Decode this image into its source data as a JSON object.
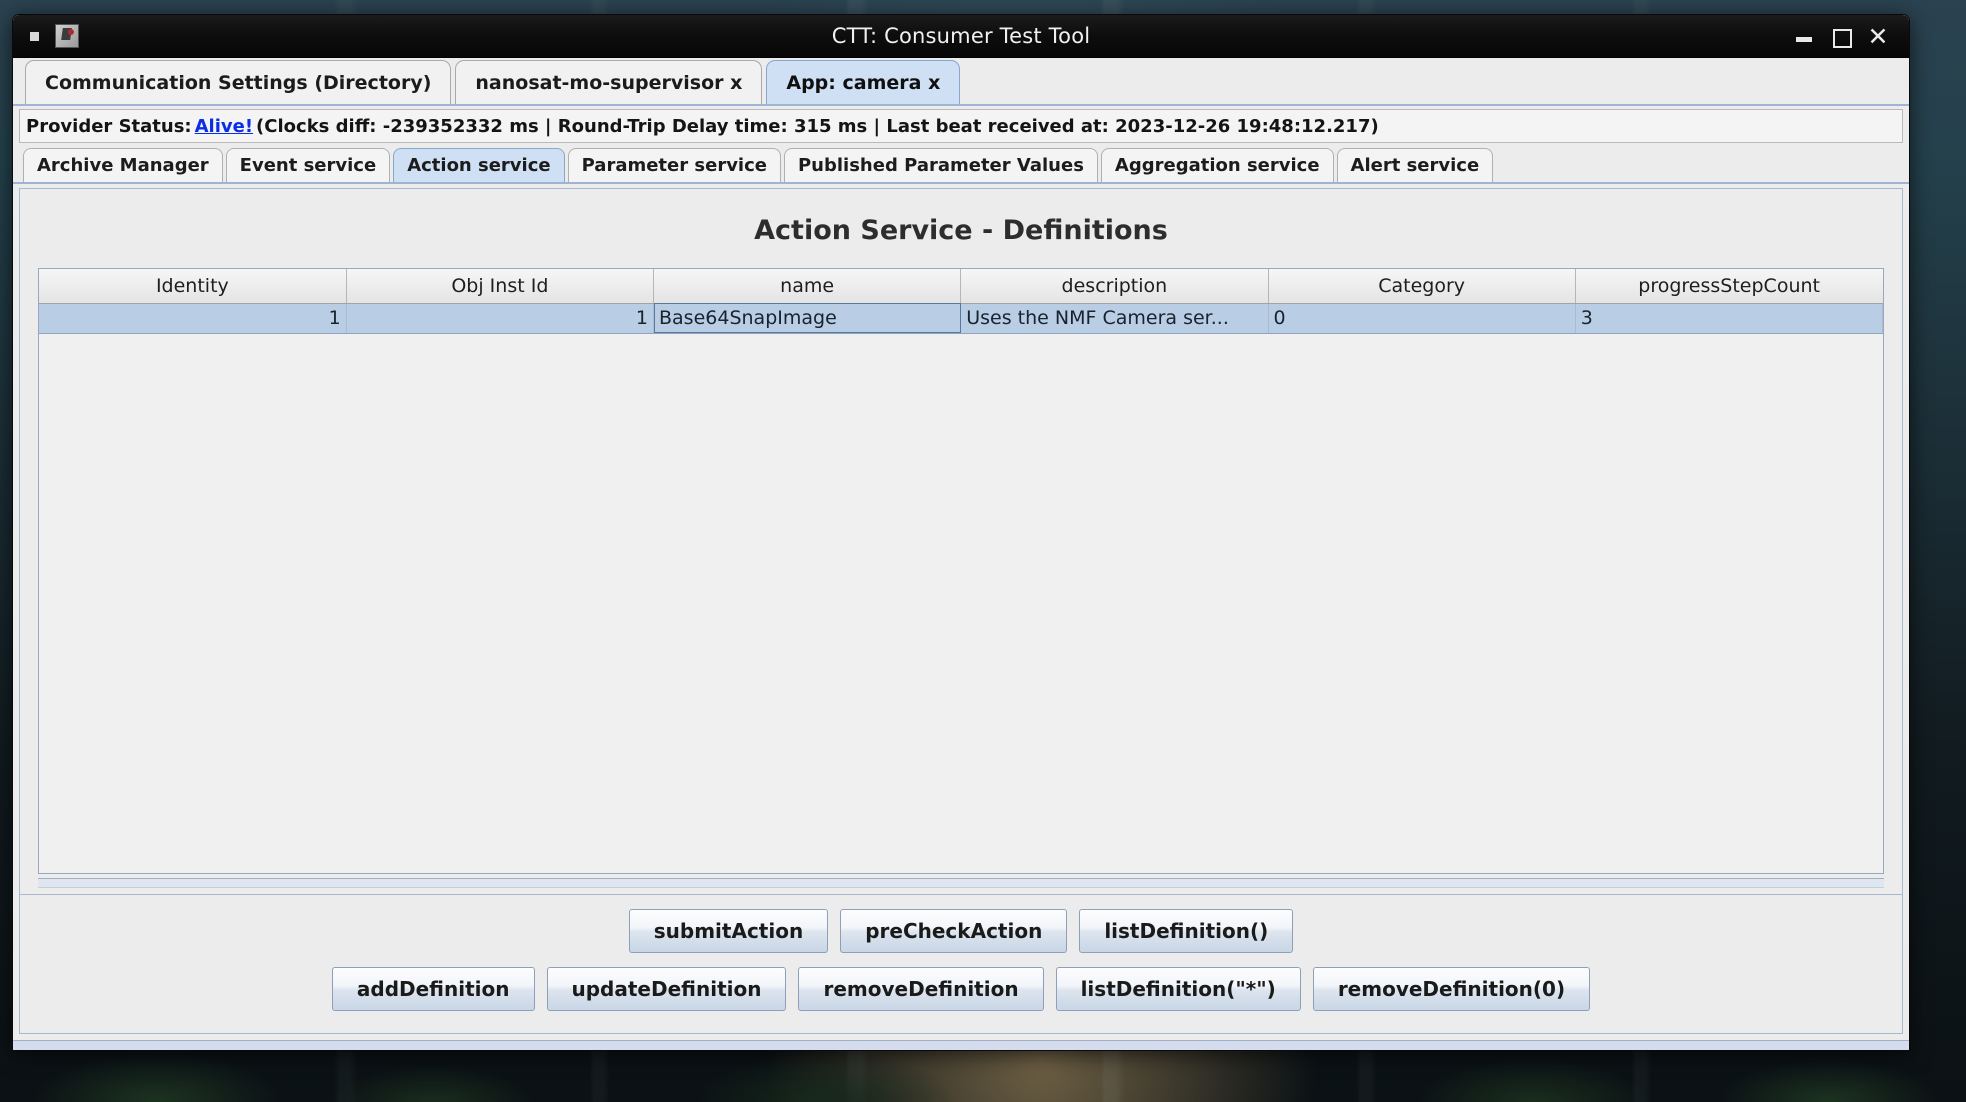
{
  "window": {
    "title": "CTT: Consumer Test Tool",
    "app_icon": "app-icon",
    "controls": {
      "minimize": "minimize-icon",
      "maximize": "maximize-icon",
      "close": "close-icon"
    }
  },
  "top_tabs": [
    {
      "label": "Communication Settings (Directory)",
      "active": false
    },
    {
      "label": "nanosat-mo-supervisor x",
      "active": false
    },
    {
      "label": "App: camera x",
      "active": true
    }
  ],
  "status": {
    "prefix": "Provider Status: ",
    "state": "Alive!",
    "details": " (Clocks diff: -239352332 ms | Round-Trip Delay time: 315 ms | Last beat received at: 2023-12-26 19:48:12.217)"
  },
  "service_tabs": [
    {
      "label": "Archive Manager",
      "active": false
    },
    {
      "label": "Event service",
      "active": false
    },
    {
      "label": "Action service",
      "active": true
    },
    {
      "label": "Parameter service",
      "active": false
    },
    {
      "label": "Published Parameter Values",
      "active": false
    },
    {
      "label": "Aggregation service",
      "active": false
    },
    {
      "label": "Alert service",
      "active": false
    }
  ],
  "page": {
    "title": "Action Service - Definitions"
  },
  "table": {
    "columns": [
      "Identity",
      "Obj Inst Id",
      "name",
      "description",
      "Category",
      "progressStepCount"
    ],
    "rows": [
      {
        "selected": true,
        "cells": [
          "1",
          "1",
          "Base64SnapImage",
          "Uses the NMF Camera ser...",
          "0",
          "3"
        ]
      }
    ]
  },
  "buttons": {
    "row1": [
      "submitAction",
      "preCheckAction",
      "listDefinition()"
    ],
    "row2": [
      "addDefinition",
      "updateDefinition",
      "removeDefinition",
      "listDefinition(\"*\")",
      "removeDefinition(0)"
    ]
  },
  "colors": {
    "selected_row": "#b9cde4",
    "active_tab": "#cfe0f5",
    "alive_link": "#0a2ee8",
    "panel": "#ececec"
  }
}
